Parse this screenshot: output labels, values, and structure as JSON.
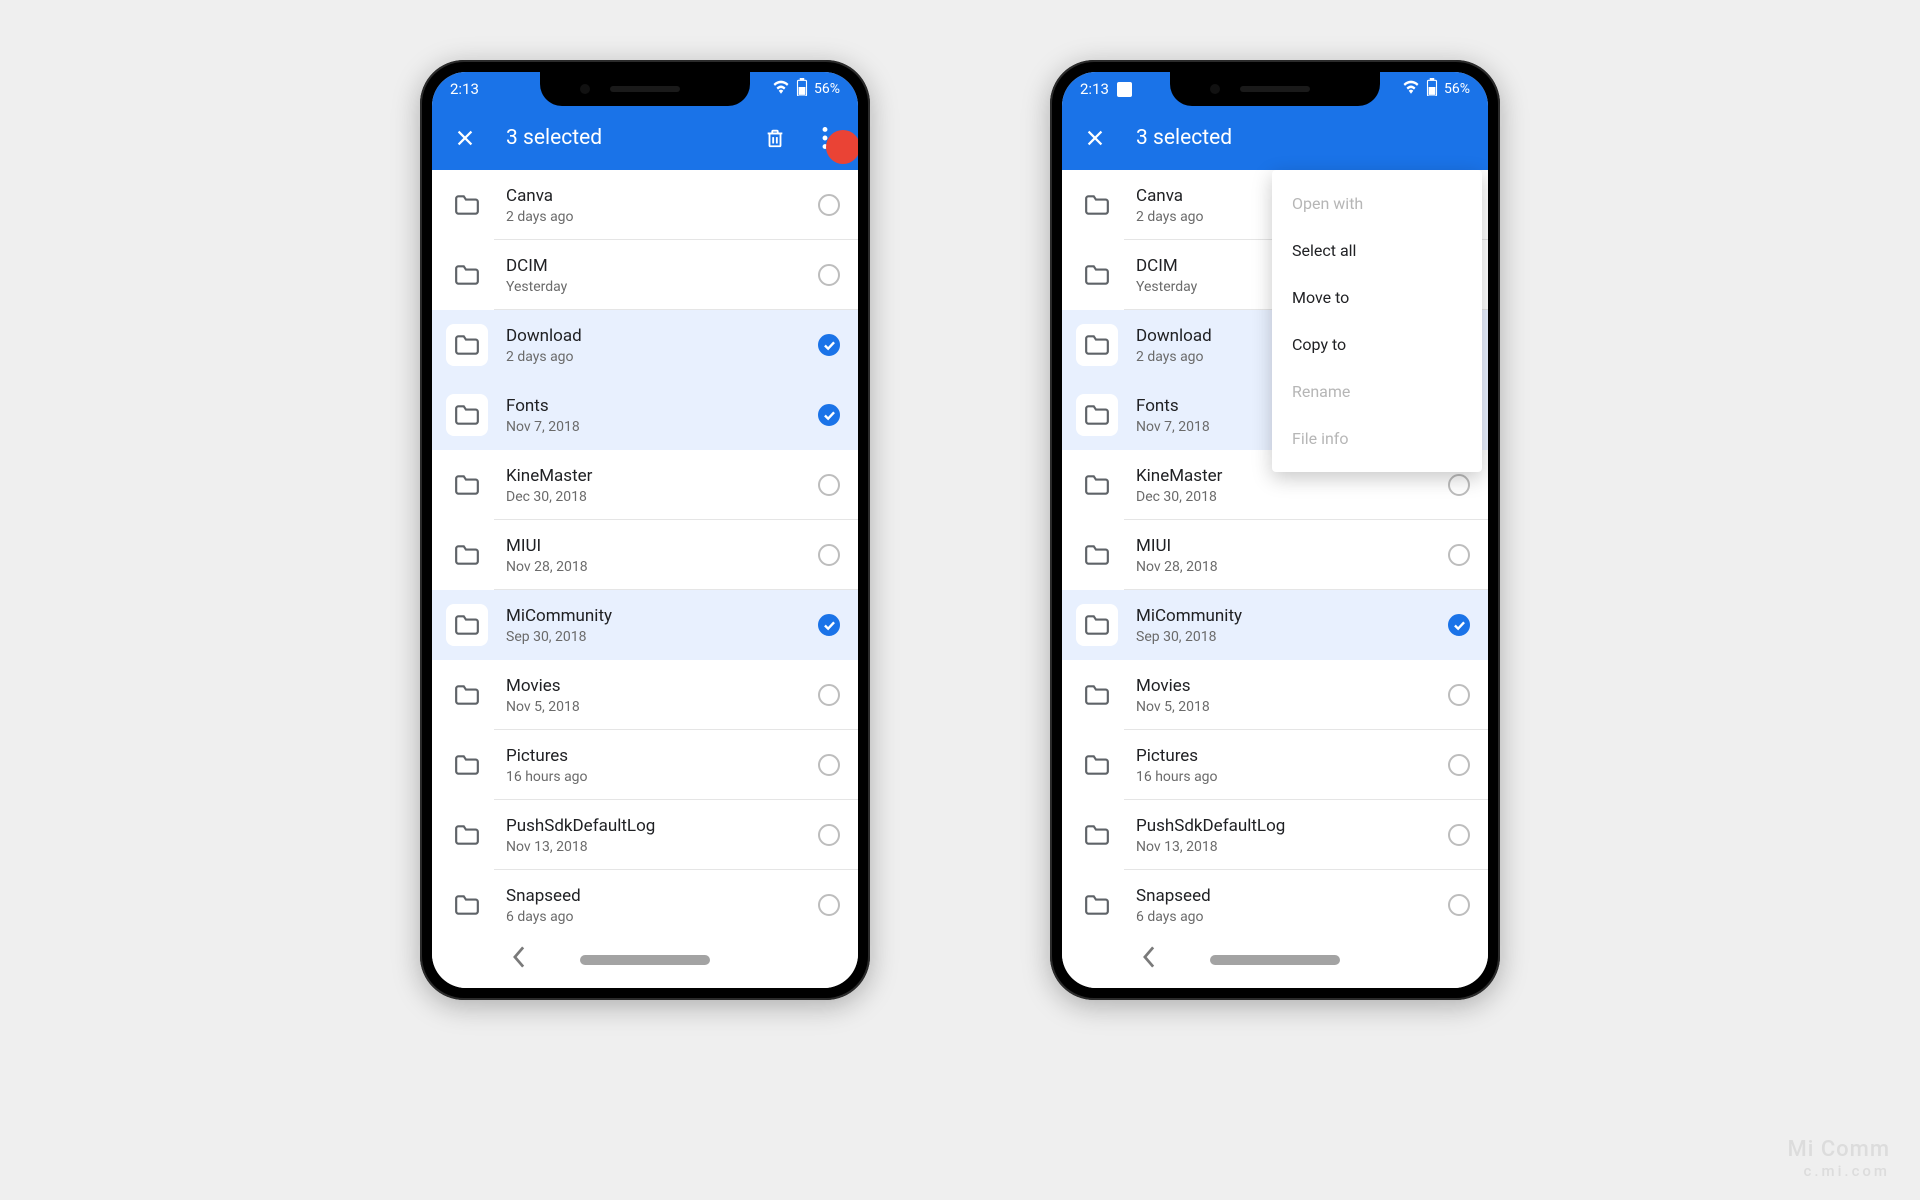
{
  "status": {
    "time": "2:13",
    "battery": "56%",
    "show_img_icon_right": true
  },
  "appbar": {
    "title": "3 selected"
  },
  "folders": [
    {
      "name": "Canva",
      "sub": "2 days ago",
      "selected": false
    },
    {
      "name": "DCIM",
      "sub": "Yesterday",
      "selected": false
    },
    {
      "name": "Download",
      "sub": "2 days ago",
      "selected": true
    },
    {
      "name": "Fonts",
      "sub": "Nov 7, 2018",
      "selected": true
    },
    {
      "name": "KineMaster",
      "sub": "Dec 30, 2018",
      "selected": false
    },
    {
      "name": "MIUI",
      "sub": "Nov 28, 2018",
      "selected": false
    },
    {
      "name": "MiCommunity",
      "sub": "Sep 30, 2018",
      "selected": true
    },
    {
      "name": "Movies",
      "sub": "Nov 5, 2018",
      "selected": false
    },
    {
      "name": "Pictures",
      "sub": "16 hours ago",
      "selected": false
    },
    {
      "name": "PushSdkDefaultLog",
      "sub": "Nov 13, 2018",
      "selected": false
    },
    {
      "name": "Snapseed",
      "sub": "6 days ago",
      "selected": false
    }
  ],
  "popup": [
    {
      "label": "Open with",
      "enabled": false
    },
    {
      "label": "Select all",
      "enabled": true
    },
    {
      "label": "Move to",
      "enabled": true
    },
    {
      "label": "Copy to",
      "enabled": true
    },
    {
      "label": "Rename",
      "enabled": false
    },
    {
      "label": "File info",
      "enabled": false
    }
  ],
  "watermark": {
    "line1": "Mi Comm",
    "line2": "c.mi.com"
  }
}
